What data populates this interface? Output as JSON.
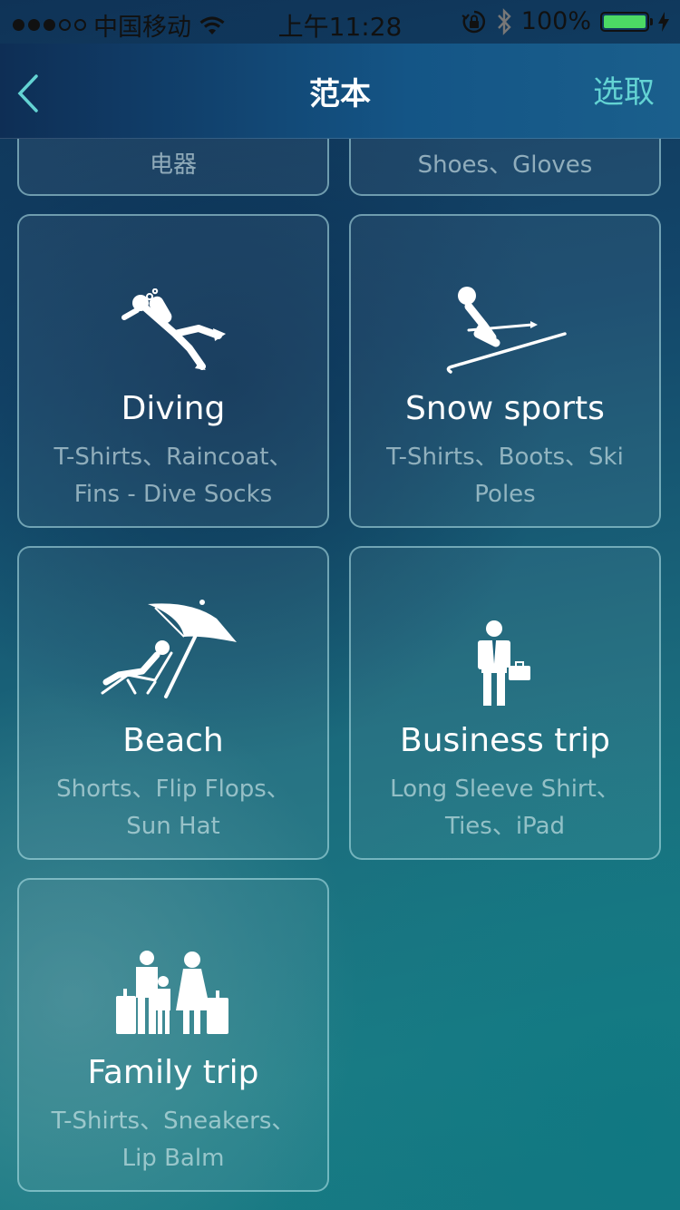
{
  "status_bar": {
    "carrier": "中国移动",
    "time": "上午11:28",
    "battery": "100%",
    "battery_level": 1.0
  },
  "nav": {
    "title": "范本",
    "action": "选取"
  },
  "cards": [
    {
      "title": "",
      "items": "电器",
      "icon": "unknown"
    },
    {
      "title": "",
      "items": "Shoes、Gloves",
      "icon": "unknown"
    },
    {
      "title": "Diving",
      "items": "T-Shirts、Raincoat、Fins - Dive Socks",
      "icon": "scuba-diver-icon"
    },
    {
      "title": "Snow sports",
      "items": "T-Shirts、Boots、Ski Poles",
      "icon": "skier-icon"
    },
    {
      "title": "Beach",
      "items": "Shorts、Flip Flops、Sun Hat",
      "icon": "beach-umbrella-icon"
    },
    {
      "title": "Business trip",
      "items": "Long Sleeve Shirt、Ties、iPad",
      "icon": "businessman-icon"
    },
    {
      "title": "Family trip",
      "items": "T-Shirts、Sneakers、Lip Balm",
      "icon": "family-icon"
    }
  ]
}
